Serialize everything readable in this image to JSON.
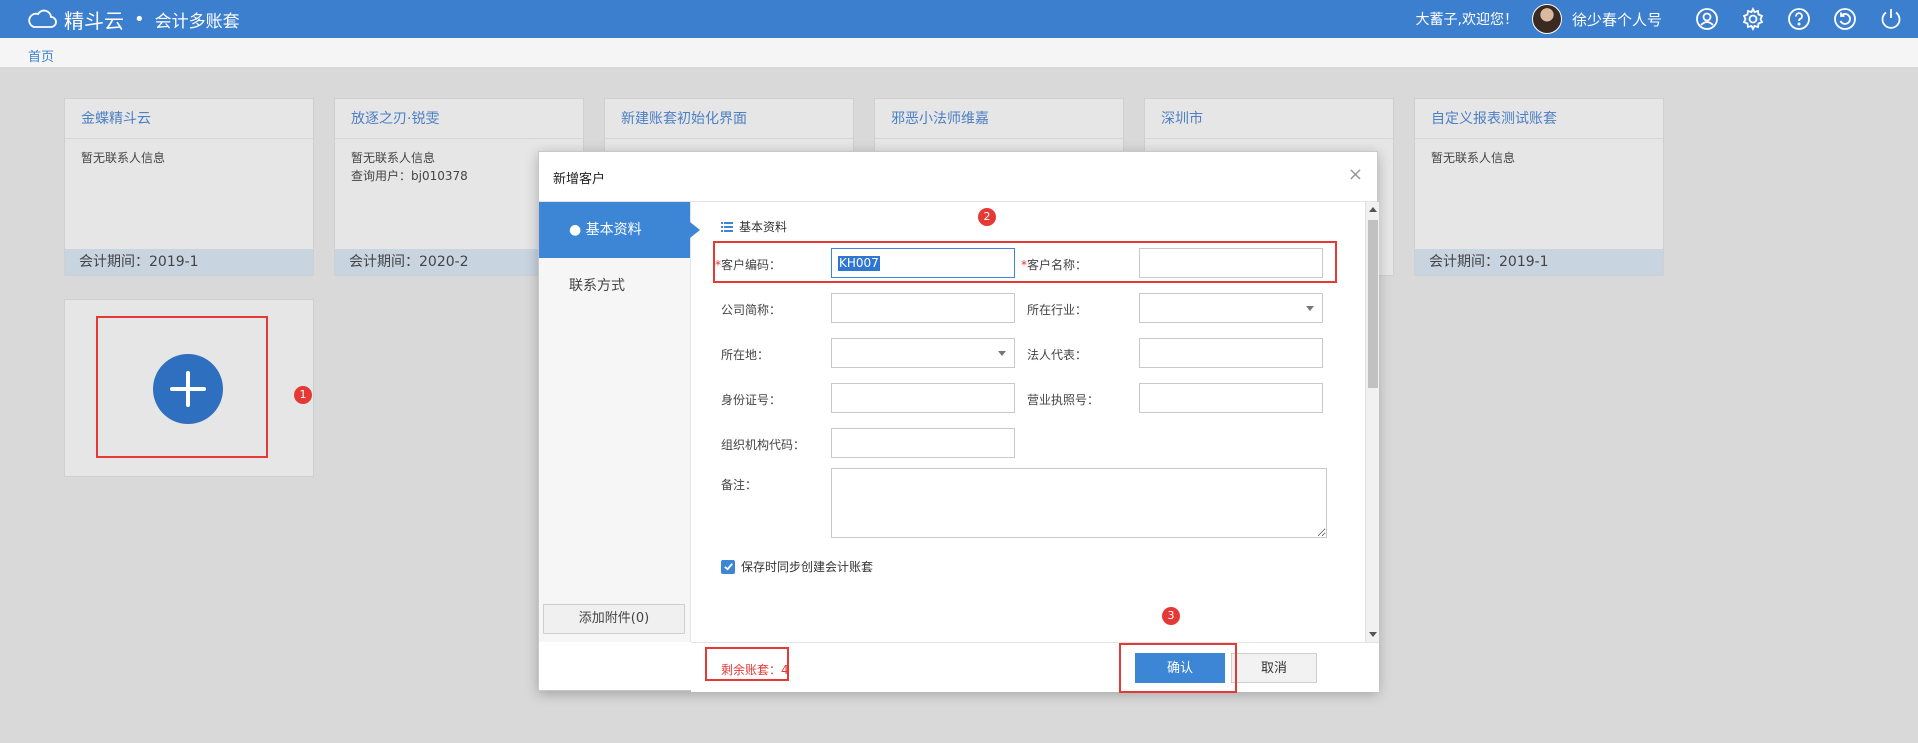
{
  "header": {
    "brand": "精斗云",
    "separator": "•",
    "product": "会计多账套",
    "welcome": "大蓄子,欢迎您！",
    "username": "徐少春个人号"
  },
  "nav": {
    "home": "首页"
  },
  "cards": [
    {
      "title": "金蝶精斗云",
      "info1": "暂无联系人信息",
      "info2": "",
      "period": "会计期间：2019-1"
    },
    {
      "title": "放逐之刃·锐雯",
      "info1": "暂无联系人信息",
      "info2": "查询用户：bj010378",
      "period": "会计期间：2020-2"
    },
    {
      "title": "新建账套初始化界面",
      "info1": "",
      "info2": "",
      "period": ""
    },
    {
      "title": "邪恶小法师维嘉",
      "info1": "",
      "info2": "",
      "period": ""
    },
    {
      "title": "深圳市",
      "info1": "",
      "info2": "",
      "period": ""
    },
    {
      "title": "自定义报表测试账套",
      "info1": "暂无联系人信息",
      "info2": "",
      "period": "会计期间：2019-1"
    }
  ],
  "badges": {
    "b1": "1",
    "b2": "2",
    "b3": "3"
  },
  "modal": {
    "title": "新增客户",
    "close": "×",
    "tabs": {
      "basic": "● 基本资料",
      "contact": "联系方式"
    },
    "attach": "添加附件(0)",
    "section": "基本资料",
    "fields": {
      "code_label": "客户编码：",
      "code_value": "KH007",
      "name_label": "客户名称：",
      "abbr_label": "公司简称：",
      "industry_label": "所在行业：",
      "location_label": "所在地：",
      "legal_label": "法人代表：",
      "id_label": "身份证号：",
      "license_label": "营业执照号：",
      "org_label": "组织机构代码：",
      "remark_label": "备注："
    },
    "required_mark": "*",
    "sync_label": "保存时同步创建会计账套",
    "remaining": "剩余账套：4",
    "ok": "确认",
    "cancel": "取消"
  },
  "colors": {
    "primary": "#3d7fcf",
    "highlight": "#e53935"
  }
}
